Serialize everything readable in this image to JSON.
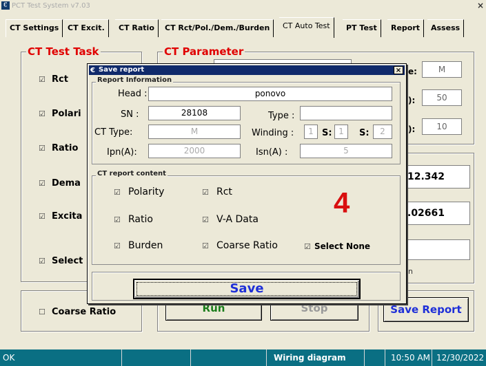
{
  "window": {
    "title": "PCT Test System v7.03",
    "close": "×"
  },
  "tabs": [
    {
      "label": "CT Settings"
    },
    {
      "label": "CT Excit."
    },
    {
      "label": "CT Ratio"
    },
    {
      "label": "CT Rct/Pol./Dem./Burden"
    },
    {
      "label": "CT Auto Test",
      "active": true
    },
    {
      "label": "PT Test"
    },
    {
      "label": "Report"
    },
    {
      "label": "Assess"
    }
  ],
  "task": {
    "title": "CT Test Task",
    "items": [
      {
        "label": "Rct",
        "checked": true
      },
      {
        "label": "Polari",
        "checked": true
      },
      {
        "label": "Ratio",
        "checked": true
      },
      {
        "label": "Dema",
        "checked": true
      },
      {
        "label": "Excita",
        "checked": true
      },
      {
        "label": "Select",
        "checked": true
      }
    ],
    "coarse": {
      "label": "Coarse Ratio",
      "checked": false
    }
  },
  "param": {
    "title": "CT Parameter",
    "fields": [
      {
        "suffix": "e:",
        "value": "M"
      },
      {
        "suffix": "):",
        "value": "50"
      },
      {
        "suffix": "):",
        "value": "10"
      }
    ]
  },
  "results": {
    "value1": "12.342",
    "value2": ".02661",
    "value3": "",
    "note": "n"
  },
  "buttons": {
    "run": "Run",
    "stop": "Stop",
    "save_report": "Save Report"
  },
  "status": {
    "ok": "OK",
    "wiring": "Wiring diagram",
    "time": "10:50 AM",
    "date": "12/30/2022"
  },
  "dialog": {
    "title": "Save report",
    "close": "×",
    "info_title": "Report Information",
    "head_label": "Head :",
    "head_value": "ponovo",
    "sn_label": "SN :",
    "sn_value": "28108",
    "type_label": "Type :",
    "type_value": "",
    "cttype_label": "CT Type:",
    "cttype_value": "M",
    "winding_label": "Winding :",
    "winding_value": "1",
    "s1_label": "S:",
    "s1_value": "1",
    "s2_label": "S:",
    "s2_value": "2",
    "ipn_label": "Ipn(A):",
    "ipn_value": "2000",
    "isn_label": "Isn(A) :",
    "isn_value": "5",
    "content_title": "CT report content",
    "content": {
      "polarity": {
        "label": "Polarity",
        "checked": true
      },
      "rct": {
        "label": "Rct",
        "checked": true
      },
      "ratio": {
        "label": "Ratio",
        "checked": true
      },
      "va": {
        "label": "V-A Data",
        "checked": true
      },
      "burden": {
        "label": "Burden",
        "checked": true
      },
      "coarse": {
        "label": "Coarse Ratio",
        "checked": true
      },
      "select_none": {
        "label": "Select None",
        "checked": true
      }
    },
    "step_number": "4",
    "save_label": "Save",
    "check_glyph": "☑",
    "uncheck_glyph": "☐"
  }
}
